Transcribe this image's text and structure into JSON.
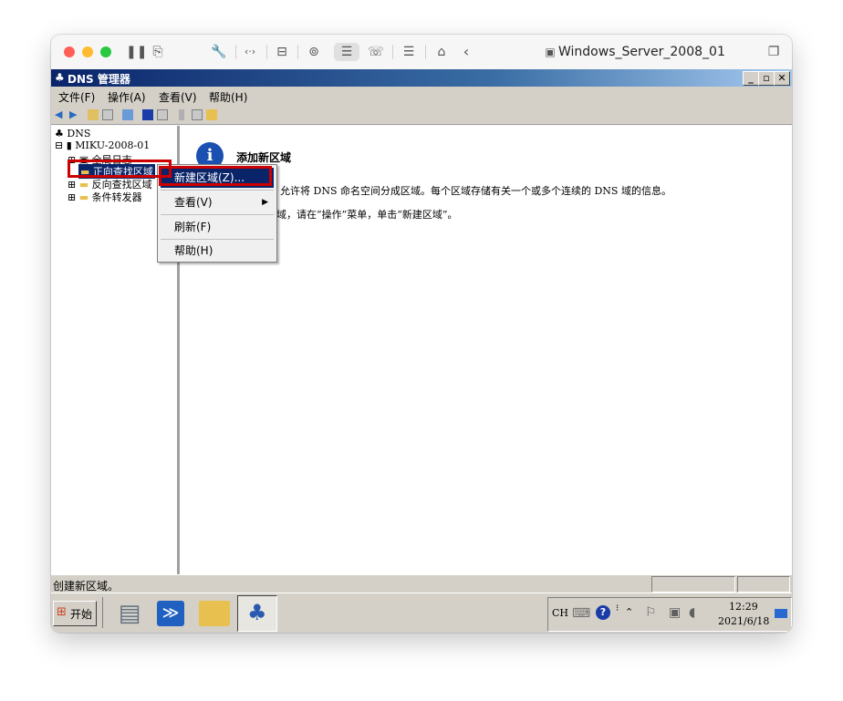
{
  "vm": {
    "window_title": "Windows_Server_2008_01"
  },
  "app": {
    "title": "DNS 管理器",
    "menu": [
      "文件(F)",
      "操作(A)",
      "查看(V)",
      "帮助(H)"
    ]
  },
  "tree": {
    "root": "DNS",
    "server": "MIKU-2008-01",
    "items": [
      "全局日志",
      "正向查找区域",
      "反向查找区域",
      "条件转发器"
    ]
  },
  "detail": {
    "heading": "添加新区域",
    "para1": "DNS 允许将 DNS 命名空间分成区域。每个区域存储有关一个或多个连续的 DNS 域的信息。",
    "para1_visible": "允许将 DNS 命名空间分成区域。每个区域存储有关一个或多个连续的 DNS 域的信息。",
    "para2_visible": "域，请在“操作”菜单，单击“新建区域”。"
  },
  "context_menu": {
    "new_zone": "新建区域(Z)...",
    "view": "查看(V)",
    "refresh": "刷新(F)",
    "help": "帮助(H)"
  },
  "status": {
    "text": "创建新区域。"
  },
  "taskbar": {
    "start": "开始",
    "lang": "CH",
    "time": "12:29",
    "date": "2021/6/18"
  }
}
